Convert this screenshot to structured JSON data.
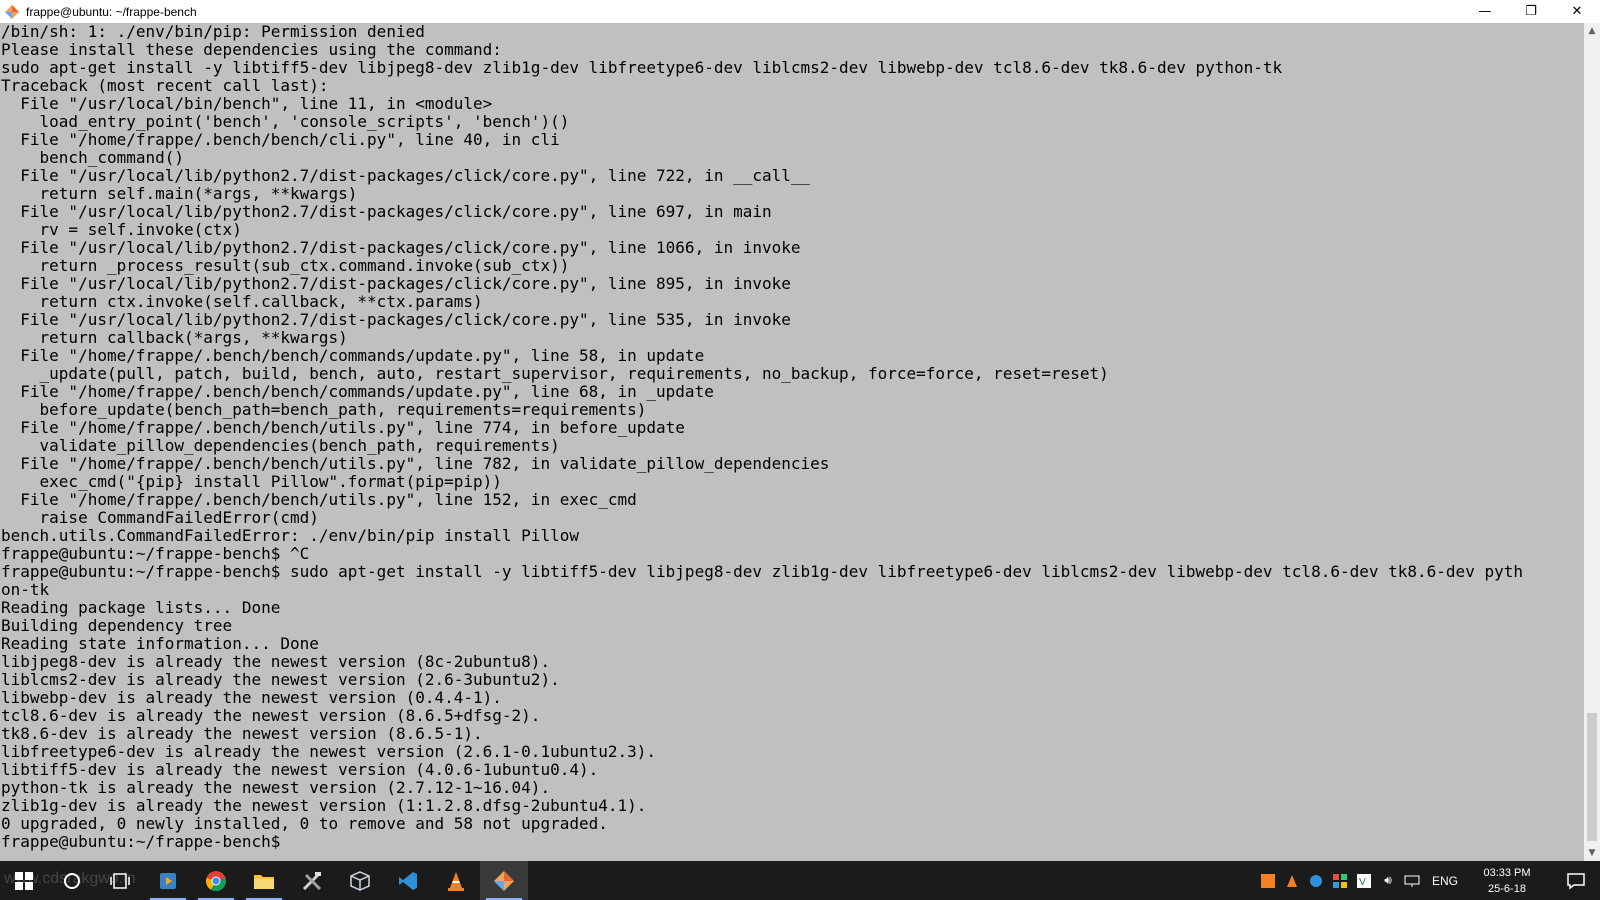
{
  "window": {
    "title": "frappe@ubuntu: ~/frappe-bench",
    "minimize_glyph": "—",
    "maximize_glyph": "❐",
    "close_glyph": "✕"
  },
  "terminal": {
    "lines": [
      "/bin/sh: 1: ./env/bin/pip: Permission denied",
      "Please install these dependencies using the command:",
      "sudo apt-get install -y libtiff5-dev libjpeg8-dev zlib1g-dev libfreetype6-dev liblcms2-dev libwebp-dev tcl8.6-dev tk8.6-dev python-tk",
      "Traceback (most recent call last):",
      "  File \"/usr/local/bin/bench\", line 11, in <module>",
      "    load_entry_point('bench', 'console_scripts', 'bench')()",
      "  File \"/home/frappe/.bench/bench/cli.py\", line 40, in cli",
      "    bench_command()",
      "  File \"/usr/local/lib/python2.7/dist-packages/click/core.py\", line 722, in __call__",
      "    return self.main(*args, **kwargs)",
      "  File \"/usr/local/lib/python2.7/dist-packages/click/core.py\", line 697, in main",
      "    rv = self.invoke(ctx)",
      "  File \"/usr/local/lib/python2.7/dist-packages/click/core.py\", line 1066, in invoke",
      "    return _process_result(sub_ctx.command.invoke(sub_ctx))",
      "  File \"/usr/local/lib/python2.7/dist-packages/click/core.py\", line 895, in invoke",
      "    return ctx.invoke(self.callback, **ctx.params)",
      "  File \"/usr/local/lib/python2.7/dist-packages/click/core.py\", line 535, in invoke",
      "    return callback(*args, **kwargs)",
      "  File \"/home/frappe/.bench/bench/commands/update.py\", line 58, in update",
      "    _update(pull, patch, build, bench, auto, restart_supervisor, requirements, no_backup, force=force, reset=reset)",
      "  File \"/home/frappe/.bench/bench/commands/update.py\", line 68, in _update",
      "    before_update(bench_path=bench_path, requirements=requirements)",
      "  File \"/home/frappe/.bench/bench/utils.py\", line 774, in before_update",
      "    validate_pillow_dependencies(bench_path, requirements)",
      "  File \"/home/frappe/.bench/bench/utils.py\", line 782, in validate_pillow_dependencies",
      "    exec_cmd(\"{pip} install Pillow\".format(pip=pip))",
      "  File \"/home/frappe/.bench/bench/utils.py\", line 152, in exec_cmd",
      "    raise CommandFailedError(cmd)",
      "bench.utils.CommandFailedError: ./env/bin/pip install Pillow",
      "frappe@ubuntu:~/frappe-bench$ ^C",
      "frappe@ubuntu:~/frappe-bench$ sudo apt-get install -y libtiff5-dev libjpeg8-dev zlib1g-dev libfreetype6-dev liblcms2-dev libwebp-dev tcl8.6-dev tk8.6-dev pyth",
      "on-tk",
      "Reading package lists... Done",
      "Building dependency tree",
      "Reading state information... Done",
      "libjpeg8-dev is already the newest version (8c-2ubuntu8).",
      "liblcms2-dev is already the newest version (2.6-3ubuntu2).",
      "libwebp-dev is already the newest version (0.4.4-1).",
      "tcl8.6-dev is already the newest version (8.6.5+dfsg-2).",
      "tk8.6-dev is already the newest version (8.6.5-1).",
      "libfreetype6-dev is already the newest version (2.6.1-0.1ubuntu2.3).",
      "libtiff5-dev is already the newest version (4.0.6-1ubuntu0.4).",
      "python-tk is already the newest version (2.7.12-1~16.04).",
      "zlib1g-dev is already the newest version (1:1.2.8.dfsg-2ubuntu4.1).",
      "0 upgraded, 0 newly installed, 0 to remove and 58 not upgraded.",
      "frappe@ubuntu:~/frappe-bench$ "
    ]
  },
  "taskbar": {
    "apps": [
      {
        "name": "start-button",
        "icon": "windows-logo-icon"
      },
      {
        "name": "cortana-button",
        "icon": "search-circle-icon"
      },
      {
        "name": "task-view-button",
        "icon": "task-view-icon"
      },
      {
        "name": "media-player-button",
        "icon": "media-player-icon"
      },
      {
        "name": "chrome-button",
        "icon": "chrome-icon"
      },
      {
        "name": "file-explorer-button",
        "icon": "folder-icon"
      },
      {
        "name": "tools-button",
        "icon": "tools-icon"
      },
      {
        "name": "virtualbox-button",
        "icon": "cube-icon"
      },
      {
        "name": "vscode-button",
        "icon": "vscode-icon"
      },
      {
        "name": "vlc-button",
        "icon": "vlc-cone-icon"
      },
      {
        "name": "terminal-app-button",
        "icon": "terminal-app-icon"
      }
    ],
    "language": "ENG",
    "time": "03:33 PM",
    "date": "25-6-18"
  },
  "watermark": "www.cdsrakgwo.in",
  "colors": {
    "terminal_bg": "#c0c0c0",
    "terminal_fg": "#000000",
    "taskbar_bg": "#1b1b1b",
    "titlebar_bg": "#ffffff"
  }
}
